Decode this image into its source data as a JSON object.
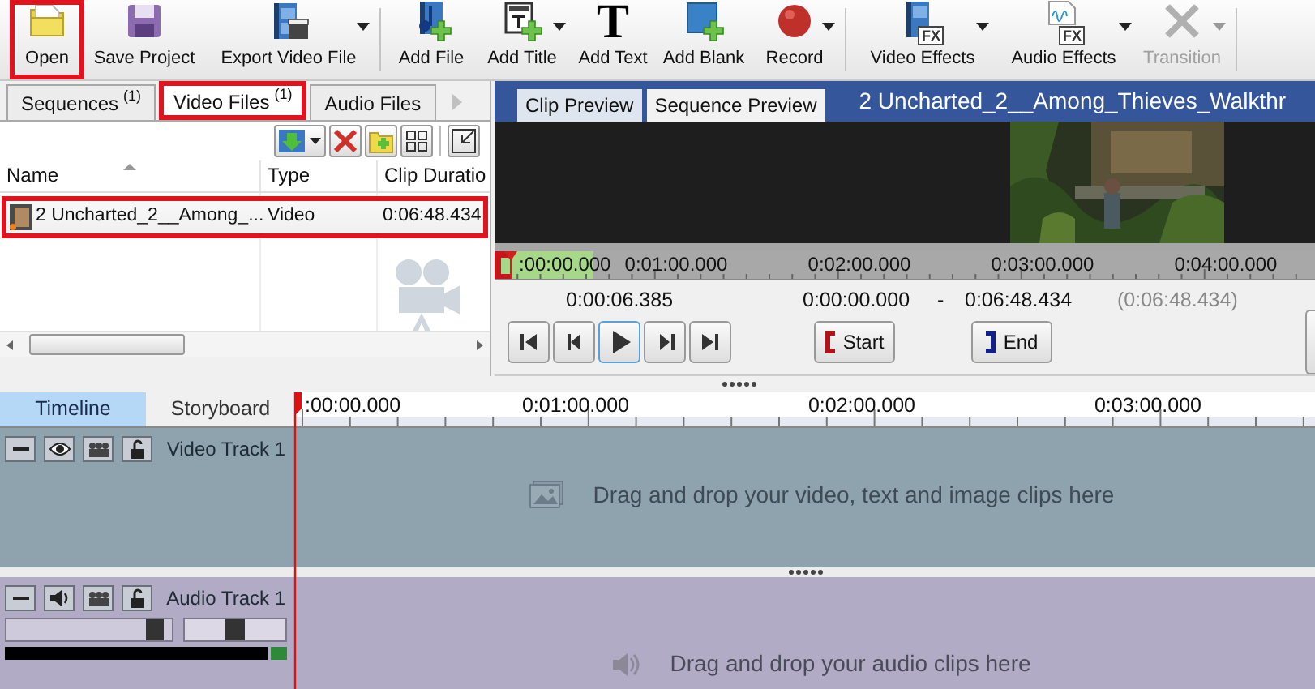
{
  "toolbar": {
    "groups": [
      [
        {
          "label": "Open",
          "dropdown": false,
          "disabled": false,
          "highlighted": true
        },
        {
          "label": "Save Project",
          "dropdown": false,
          "disabled": false,
          "highlighted": false
        },
        {
          "label": "Export Video File",
          "dropdown": true,
          "disabled": false,
          "highlighted": false
        }
      ],
      [
        {
          "label": "Add File",
          "dropdown": false,
          "disabled": false,
          "highlighted": false
        },
        {
          "label": "Add Title",
          "dropdown": true,
          "disabled": false,
          "highlighted": false
        },
        {
          "label": "Add Text",
          "icon_text": "T",
          "dropdown": false,
          "disabled": false,
          "highlighted": false
        },
        {
          "label": "Add Blank",
          "dropdown": false,
          "disabled": false,
          "highlighted": false
        },
        {
          "label": "Record",
          "dropdown": true,
          "disabled": false,
          "highlighted": false
        }
      ],
      [
        {
          "label": "Video Effects",
          "icon_text": "FX",
          "dropdown": true,
          "disabled": false,
          "highlighted": false
        },
        {
          "label": "Audio Effects",
          "icon_text": "FX",
          "dropdown": true,
          "disabled": false,
          "highlighted": false
        },
        {
          "label": "Transition",
          "dropdown": true,
          "disabled": true,
          "highlighted": false
        }
      ]
    ]
  },
  "library": {
    "tabs": [
      {
        "label": "Sequences",
        "count": "(1)",
        "selected": false,
        "highlighted": false
      },
      {
        "label": "Video Files",
        "count": "(1)",
        "selected": true,
        "highlighted": true
      },
      {
        "label": "Audio Files",
        "selected": false,
        "highlighted": false
      }
    ],
    "columns": [
      "Name",
      "Type",
      "Clip Duratio"
    ],
    "rows": [
      {
        "cells": [
          "2 Uncharted_2__Among_...",
          "Video",
          "0:06:48.434"
        ],
        "selected": false,
        "highlighted": true
      }
    ]
  },
  "preview": {
    "tabs": [
      {
        "label": "Clip Preview",
        "selected": true
      },
      {
        "label": "Sequence Preview",
        "selected": false
      }
    ],
    "title": "2  Uncharted_2__Among_Thieves_Walkthr",
    "ruler": [
      ":00:00.000",
      "0:01:00.000",
      "0:02:00.000",
      "0:03:00.000",
      "0:04:00.000"
    ],
    "current_time": "0:00:06.385",
    "range_start": "0:00:00.000",
    "range_separator": "-",
    "range_end": "0:06:48.434",
    "duration": "(0:06:48.434)",
    "start_button": "Start",
    "end_button": "End"
  },
  "timeline": {
    "tabs": [
      {
        "label": "Timeline",
        "selected": true
      },
      {
        "label": "Storyboard",
        "selected": false
      }
    ],
    "ruler": [
      ":00:00.000",
      "0:01:00.000",
      "0:02:00.000",
      "0:03:00.000"
    ],
    "tracks": [
      {
        "kind": "video",
        "name": "Video Track 1",
        "hint": "Drag and drop your video, text and image clips here"
      },
      {
        "kind": "audio",
        "name": "Audio Track 1",
        "hint": "Drag and drop your audio clips here",
        "volume": {
          "level": 0.95
        },
        "pan": {
          "level": 0.5
        }
      }
    ]
  }
}
